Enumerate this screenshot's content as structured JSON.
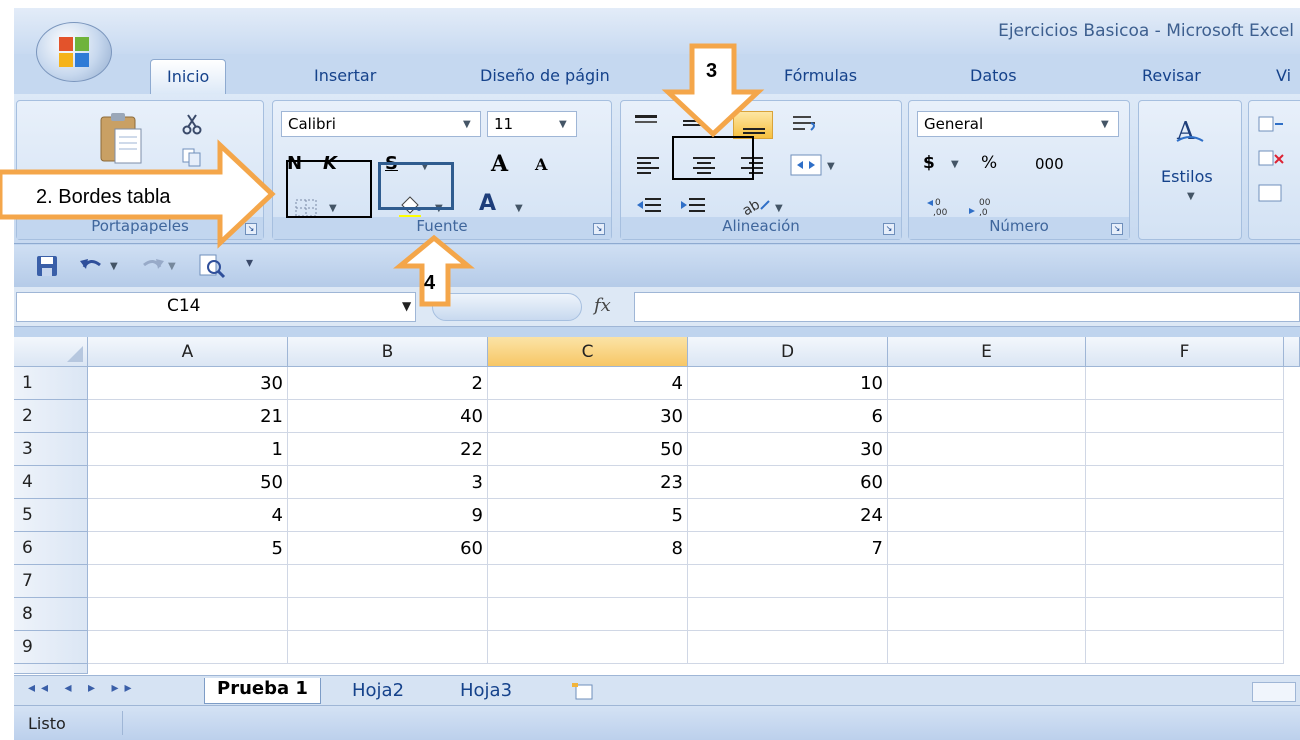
{
  "window": {
    "title": "Ejercicios Basicoa - Microsoft Excel"
  },
  "ribbon_tabs": [
    {
      "label": "Inicio",
      "active": true
    },
    {
      "label": "Insertar",
      "active": false
    },
    {
      "label": "Diseño de págin",
      "active": false
    },
    {
      "label": "Fórmulas",
      "active": false
    },
    {
      "label": "Datos",
      "active": false
    },
    {
      "label": "Revisar",
      "active": false
    },
    {
      "label": "Vi",
      "active": false
    }
  ],
  "ribbon": {
    "clipboard_label": "Portapapeles",
    "font_name": "Calibri",
    "font_size": "11",
    "bold": "N",
    "italic": "K",
    "underline": "S",
    "grow_font": "A",
    "shrink_font": "A",
    "font_color_glyph": "A",
    "font_group_label": "Fuente",
    "alignment_group_label": "Alineación",
    "number_format": "General",
    "currency": "$",
    "percent": "%",
    "thousands": "000",
    "number_group_label": "Número",
    "styles_label": "Estilos"
  },
  "formula_bar": {
    "name_box": "C14",
    "fx": "fx",
    "formula": ""
  },
  "grid": {
    "columns": [
      "A",
      "B",
      "C",
      "D",
      "E",
      "F"
    ],
    "selected_column": "C",
    "rows": [
      {
        "n": "1",
        "cells": [
          "30",
          "2",
          "4",
          "10",
          "",
          ""
        ]
      },
      {
        "n": "2",
        "cells": [
          "21",
          "40",
          "30",
          "6",
          "",
          ""
        ]
      },
      {
        "n": "3",
        "cells": [
          "1",
          "22",
          "50",
          "30",
          "",
          ""
        ]
      },
      {
        "n": "4",
        "cells": [
          "50",
          "3",
          "23",
          "60",
          "",
          ""
        ]
      },
      {
        "n": "5",
        "cells": [
          "4",
          "9",
          "5",
          "24",
          "",
          ""
        ]
      },
      {
        "n": "6",
        "cells": [
          "5",
          "60",
          "8",
          "7",
          "",
          ""
        ]
      },
      {
        "n": "7",
        "cells": [
          "",
          "",
          "",
          "",
          "",
          ""
        ]
      },
      {
        "n": "8",
        "cells": [
          "",
          "",
          "",
          "",
          "",
          ""
        ]
      },
      {
        "n": "9",
        "cells": [
          "",
          "",
          "",
          "",
          "",
          ""
        ]
      }
    ]
  },
  "sheets": [
    {
      "label": "Prueba 1",
      "active": true
    },
    {
      "label": "Hoja2",
      "active": false
    },
    {
      "label": "Hoja3",
      "active": false
    }
  ],
  "status": {
    "text": "Listo"
  },
  "annotations": {
    "callout_2": "2. Bordes tabla",
    "arrow_3": "3",
    "arrow_4": "4"
  },
  "colors": {
    "accent_orange": "#f4a64a",
    "selected_header": "#f7c766",
    "ribbon_blue": "#c7d9f0"
  }
}
